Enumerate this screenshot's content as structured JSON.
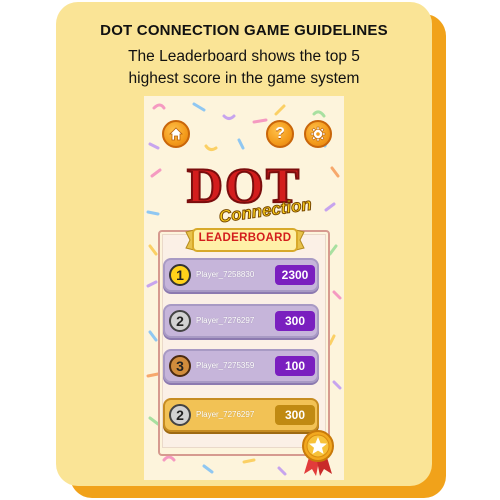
{
  "guidelines": {
    "title": "DOT CONNECTION GAME GUIDELINES",
    "subtitle_line1": "The Leaderboard shows the top 5",
    "subtitle_line2": "highest score in the game system"
  },
  "logo": {
    "word1": "DOT",
    "word2": "Connection"
  },
  "top_buttons": [
    {
      "icon": "home-icon"
    },
    {
      "icon": "help-icon",
      "glyph": "?"
    },
    {
      "icon": "gear-icon"
    }
  ],
  "leaderboard": {
    "title": "LEADERBOARD",
    "rows": [
      {
        "rank": "1",
        "player": "Player_7258830",
        "score": "2300"
      },
      {
        "rank": "2",
        "player": "Player_7276297",
        "score": "300"
      },
      {
        "rank": "3",
        "player": "Player_7275359",
        "score": "100"
      }
    ],
    "current_player": {
      "rank": "2",
      "player": "Player_7276297",
      "score": "300"
    }
  },
  "colors": {
    "card": "#fae496",
    "card_shadow": "#f1a21a",
    "row_purple": "#c6b5da",
    "score_purple": "#7a1fbf",
    "row_gold": "#f2c255",
    "logo_red": "#d31d1d"
  }
}
